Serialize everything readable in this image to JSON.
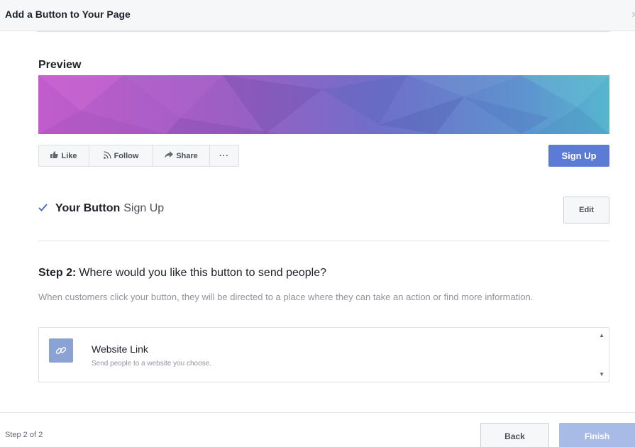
{
  "dialog": {
    "title": "Add a Button to Your Page",
    "close_glyph": "x"
  },
  "preview": {
    "title": "Preview",
    "cover_colors": [
      "#b85ec8",
      "#8a5fc0",
      "#6e78c8",
      "#5d9ccc",
      "#58b8cf"
    ],
    "actions": {
      "like": {
        "label": "Like",
        "icon": "thumbs-up-icon"
      },
      "follow": {
        "label": "Follow",
        "icon": "rss-icon"
      },
      "share": {
        "label": "Share",
        "icon": "share-arrow-icon"
      },
      "more": {
        "label": "···",
        "icon": "more-dots-icon"
      }
    },
    "cta_label": "Sign Up",
    "cta_color": "#5b7bd5"
  },
  "your_button": {
    "label": "Your Button",
    "value": "Sign Up",
    "edit_label": "Edit",
    "check_icon": "checkmark-icon"
  },
  "step2": {
    "prefix": "Step 2:",
    "question": "Where would you like this button to send people?",
    "description": "When customers click your button, they will be directed to a place where they can take an action or find more information."
  },
  "option": {
    "title": "Website Link",
    "subtitle": "Send people to a website you choose.",
    "icon": "link-icon",
    "tile_color": "#8ba3d4"
  },
  "footer": {
    "step_count": "Step 2 of 2",
    "back_label": "Back",
    "finish_label": "Finish",
    "finish_color": "#a7bbe6"
  }
}
